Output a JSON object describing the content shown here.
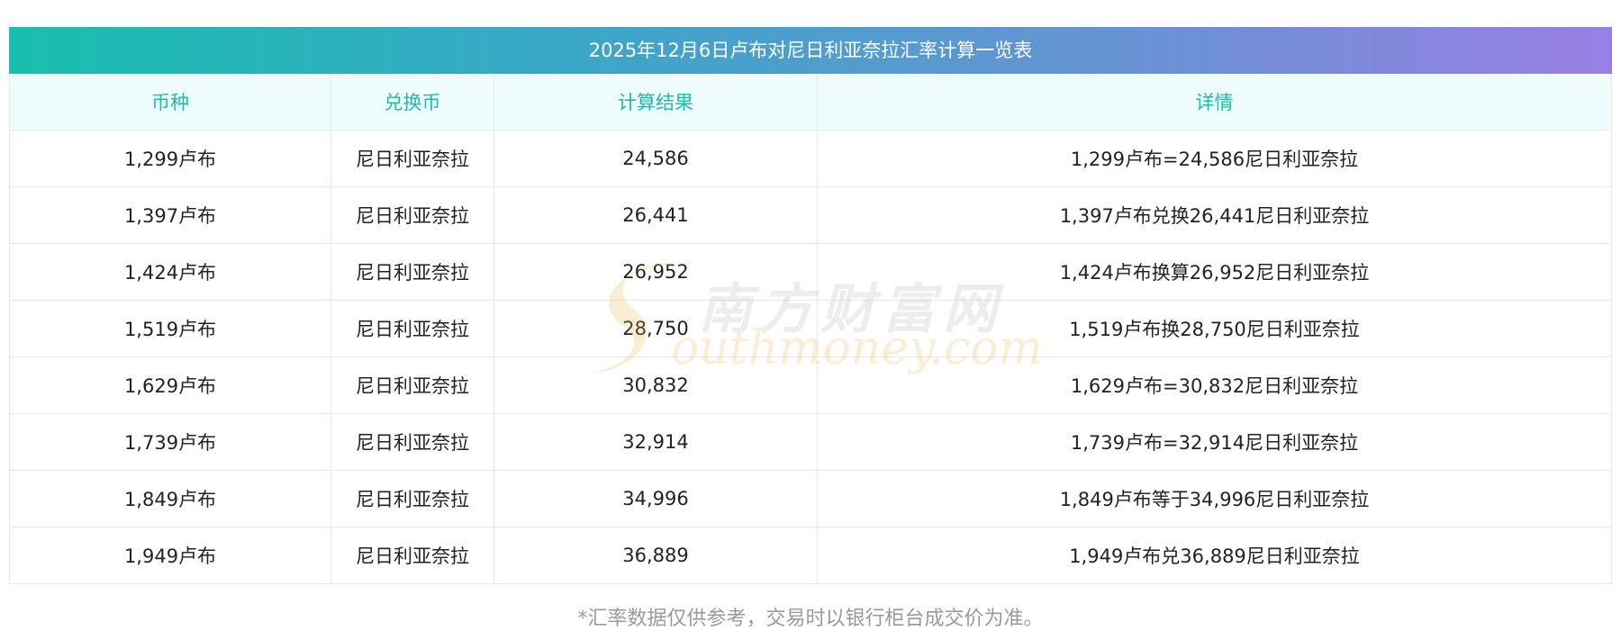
{
  "title": "2025年12月6日卢布对尼日利亚奈拉汇率计算一览表",
  "headers": [
    "币种",
    "兑换币",
    "计算结果",
    "详情"
  ],
  "rows": [
    {
      "currency": "1,299卢布",
      "target": "尼日利亚奈拉",
      "result": "24,586",
      "detail": "1,299卢布=24,586尼日利亚奈拉"
    },
    {
      "currency": "1,397卢布",
      "target": "尼日利亚奈拉",
      "result": "26,441",
      "detail": "1,397卢布兑换26,441尼日利亚奈拉"
    },
    {
      "currency": "1,424卢布",
      "target": "尼日利亚奈拉",
      "result": "26,952",
      "detail": "1,424卢布换算26,952尼日利亚奈拉"
    },
    {
      "currency": "1,519卢布",
      "target": "尼日利亚奈拉",
      "result": "28,750",
      "detail": "1,519卢布换28,750尼日利亚奈拉"
    },
    {
      "currency": "1,629卢布",
      "target": "尼日利亚奈拉",
      "result": "30,832",
      "detail": "1,629卢布=30,832尼日利亚奈拉"
    },
    {
      "currency": "1,739卢布",
      "target": "尼日利亚奈拉",
      "result": "32,914",
      "detail": "1,739卢布=32,914尼日利亚奈拉"
    },
    {
      "currency": "1,849卢布",
      "target": "尼日利亚奈拉",
      "result": "34,996",
      "detail": "1,849卢布等于34,996尼日利亚奈拉"
    },
    {
      "currency": "1,949卢布",
      "target": "尼日利亚奈拉",
      "result": "36,889",
      "detail": "1,949卢布兑36,889尼日利亚奈拉"
    }
  ],
  "note": "*汇率数据仅供参考，交易时以银行柜台成交价为准。",
  "watermark": {
    "cn": "南方财富网",
    "en": "outhmoney.com"
  },
  "colors": {
    "header_text": "#22b8ab",
    "header_bg": "#eefdfc",
    "title_gradient_start": "#19bfae",
    "title_gradient_end": "#9a7fe4"
  }
}
